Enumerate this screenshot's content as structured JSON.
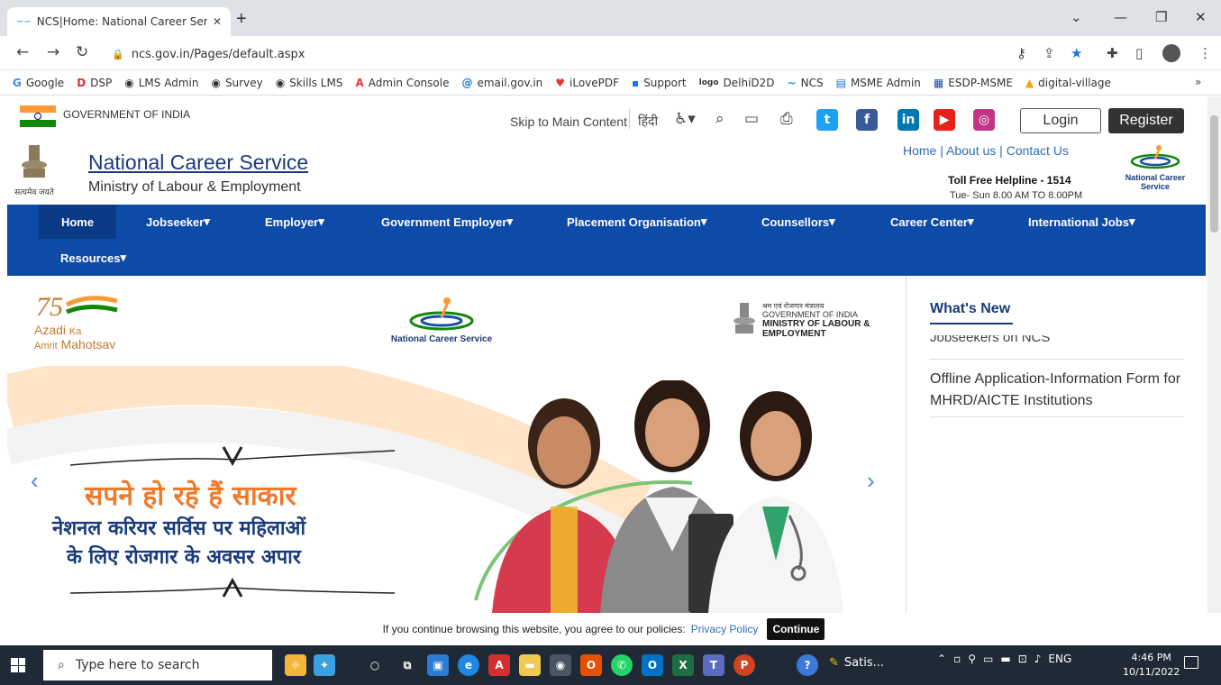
{
  "browser": {
    "tab_title": "NCS|Home: National Career Serv",
    "url": "ncs.gov.in/Pages/default.aspx",
    "bookmarks": [
      "Google",
      "DSP",
      "LMS Admin",
      "Survey",
      "Skills LMS",
      "Admin Console",
      "email.gov.in",
      "iLovePDF",
      "Support",
      "DelhiD2D",
      "NCS",
      "MSME Admin",
      "ESDP-MSME",
      "digital-village"
    ],
    "bookmark_icons": [
      "G",
      "D",
      "◉",
      "◉",
      "◉",
      "A",
      "@",
      "♥",
      "▪",
      "logo",
      "∼",
      "▤",
      "▦",
      "▲"
    ]
  },
  "gov_bar": {
    "title": "GOVERNMENT OF INDIA",
    "skip_link": "Skip to Main Content",
    "hindi_link": "हिंदी",
    "login": "Login",
    "register": "Register"
  },
  "header": {
    "emblem_motto": "सत्यमेव जयते",
    "site_title": "National Career Service",
    "site_subtitle": "Ministry of Labour & Employment",
    "links": [
      "Home",
      "About us",
      "Contact Us"
    ],
    "helpline": "Toll Free Helpline - 1514",
    "hours": "Tue- Sun 8.00 AM TO 8.00PM",
    "logo_text": "National Career Service"
  },
  "nav": {
    "row1": [
      "Home",
      "Jobseeker",
      "Employer",
      "Government Employer",
      "Placement Organisation",
      "Counsellors",
      "Career Center",
      "International Jobs"
    ],
    "row2": [
      "Resources"
    ],
    "active": "Home"
  },
  "banner": {
    "azadi_line1": "Azadi",
    "azadi_ka": "Ka",
    "azadi_line2": "Amrit",
    "azadi_mahotsav": "Mahotsav",
    "ncs_logo_text": "National Career Service",
    "ministry_hindi": "श्रम एवं रोजगार मंत्रालय",
    "ministry_line1": "GOVERNMENT OF INDIA",
    "ministry_line2": "MINISTRY OF LABOUR &",
    "ministry_line3": "EMPLOYMENT",
    "hindi_headline": "सपने हो रहे हैं साकार",
    "hindi_line2": "नेशनल करियर सर्विस पर महिलाओं",
    "hindi_line3": "के लिए रोजगार के अवसर अपार"
  },
  "whats_new": {
    "title": "What's New",
    "clipped_item": "Jobseekers on NCS",
    "item": "Offline Application-Information Form for MHRD/AICTE Institutions"
  },
  "cookie": {
    "text": "If you continue browsing this website, you agree to our policies:",
    "link": "Privacy Policy",
    "button": "Continue"
  },
  "taskbar": {
    "search_placeholder": "Type here to search",
    "active_app": "Satis...",
    "lang": "ENG",
    "time": "4:46 PM",
    "date": "10/11/2022"
  },
  "colors": {
    "nav_blue": "#0e4aa8",
    "title_blue": "#1a3b7a",
    "link_blue": "#2f6db5",
    "saffron": "#ff9933",
    "green": "#138808"
  }
}
